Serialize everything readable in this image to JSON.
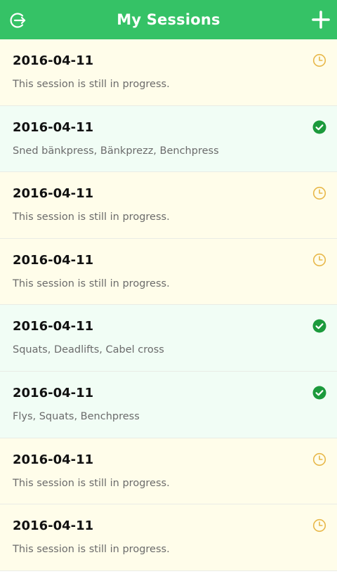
{
  "header": {
    "title": "My Sessions",
    "logout_icon": "logout-icon",
    "add_icon": "plus-icon"
  },
  "colors": {
    "header_bg": "#35c266",
    "pending_bg": "#fffdea",
    "done_bg": "#f1fdf5",
    "pending_icon": "#e8b84a",
    "done_icon": "#1c9a3c"
  },
  "sessions": [
    {
      "date": "2016-04-11",
      "description": "This session is still in progress.",
      "status": "pending"
    },
    {
      "date": "2016-04-11",
      "description": "Sned bänkpress, Bänkprezz, Benchpress",
      "status": "done"
    },
    {
      "date": "2016-04-11",
      "description": "This session is still in progress.",
      "status": "pending"
    },
    {
      "date": "2016-04-11",
      "description": "This session is still in progress.",
      "status": "pending"
    },
    {
      "date": "2016-04-11",
      "description": "Squats, Deadlifts, Cabel cross",
      "status": "done"
    },
    {
      "date": "2016-04-11",
      "description": "Flys, Squats, Benchpress",
      "status": "done"
    },
    {
      "date": "2016-04-11",
      "description": "This session is still in progress.",
      "status": "pending"
    },
    {
      "date": "2016-04-11",
      "description": "This session is still in progress.",
      "status": "pending"
    }
  ]
}
